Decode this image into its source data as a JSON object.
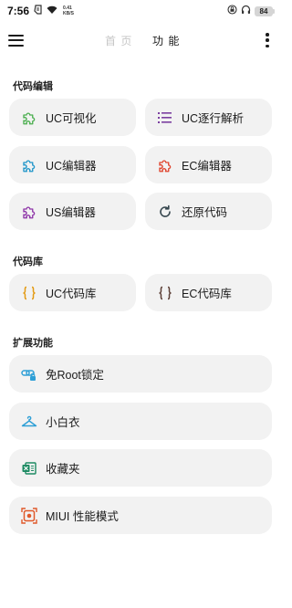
{
  "status_bar": {
    "time": "7:56",
    "speed_value": "0.41",
    "speed_unit": "KB/S",
    "battery": "84"
  },
  "header": {
    "tabs": [
      {
        "label": "首 页",
        "active": false
      },
      {
        "label": "功 能",
        "active": true
      }
    ]
  },
  "sections": {
    "code_edit": {
      "title": "代码编辑",
      "items": [
        {
          "label": "UC可视化",
          "icon": "puzzle-icon",
          "color": "#4caf50"
        },
        {
          "label": "UC逐行解析",
          "icon": "list-icon",
          "color": "#7b3fa0"
        },
        {
          "label": "UC编辑器",
          "icon": "puzzle-icon",
          "color": "#2196c9"
        },
        {
          "label": "EC编辑器",
          "icon": "puzzle-icon",
          "color": "#e0452f"
        },
        {
          "label": "US编辑器",
          "icon": "puzzle-icon",
          "color": "#8e35a8"
        },
        {
          "label": "还原代码",
          "icon": "refresh-icon",
          "color": "#37474f"
        }
      ]
    },
    "code_lib": {
      "title": "代码库",
      "items": [
        {
          "label": "UC代码库",
          "icon": "braces-icon",
          "color": "#e39a12"
        },
        {
          "label": "EC代码库",
          "icon": "braces-icon",
          "color": "#5d4037"
        }
      ]
    },
    "extensions": {
      "title": "扩展功能",
      "items": [
        {
          "label": "免Root锁定",
          "icon": "link-lock-icon",
          "color": "#2e9fd6"
        },
        {
          "label": "小白衣",
          "icon": "hanger-icon",
          "color": "#2e9fd6"
        },
        {
          "label": "收藏夹",
          "icon": "folder-icon",
          "color": "#1c8a62"
        },
        {
          "label": "MIUI 性能模式",
          "icon": "chip-icon",
          "color": "#e0592a"
        }
      ]
    }
  }
}
